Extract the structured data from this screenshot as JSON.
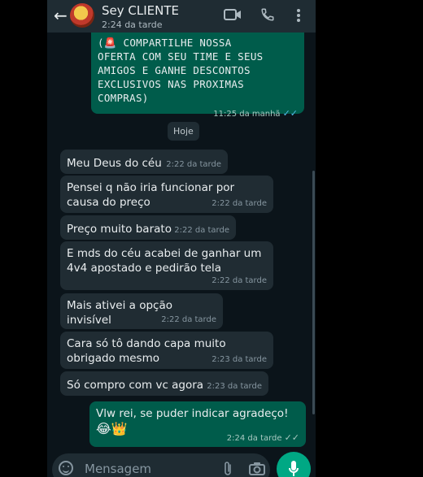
{
  "header": {
    "contact_name": "Sey CLIENTE",
    "last_seen": "2:24 da tarde"
  },
  "messages": {
    "m0": {
      "text": "(🚨 COMPARTILHE NOSSA\nOFERTA COM SEU TIME E SEUS\nAMIGOS E GANHE DESCONTOS\nEXCLUSIVOS NAS PROXIMAS\nCOMPRAS)",
      "time": "11:25 da manhã",
      "status": "read"
    },
    "date_chip": "Hoje",
    "m1": {
      "text": "Meu Deus do céu",
      "time": "2:22 da tarde"
    },
    "m2": {
      "text": "Pensei q não iria funcionar por causa do preço",
      "time": "2:22 da tarde"
    },
    "m3": {
      "text": "Preço muito barato",
      "time": "2:22 da tarde"
    },
    "m4": {
      "text": "E mds do céu acabei de ganhar um 4v4 apostado e pedirão tela",
      "time": "2:22 da tarde"
    },
    "m5": {
      "text": "Mais ativei a opção invisível",
      "time": "2:22 da tarde"
    },
    "m6": {
      "text": "Cara só tô dando capa muito obrigado mesmo",
      "time": "2:23 da tarde"
    },
    "m7": {
      "text": "Só compro com vc agora",
      "time": "2:23 da tarde"
    },
    "m8": {
      "text": "Vlw rei, se puder indicar agradeço!",
      "emoji": "😂👑",
      "time": "2:24 da tarde",
      "status": "read"
    }
  },
  "composer": {
    "placeholder": "Mensagem"
  },
  "icons": {
    "back": "arrow-left-icon",
    "video": "video-call-icon",
    "call": "phone-icon",
    "menu": "more-vert-icon",
    "emoji": "emoji-icon",
    "attach": "paperclip-icon",
    "camera": "camera-icon",
    "mic": "microphone-icon",
    "read": "double-check-icon"
  },
  "colors": {
    "header_bg": "#1f2c33",
    "chat_bg": "#0b141a",
    "incoming_bubble": "#202c33",
    "outgoing_bubble": "#005c4b",
    "accent": "#00a884",
    "read_ticks": "#53bdeb"
  }
}
